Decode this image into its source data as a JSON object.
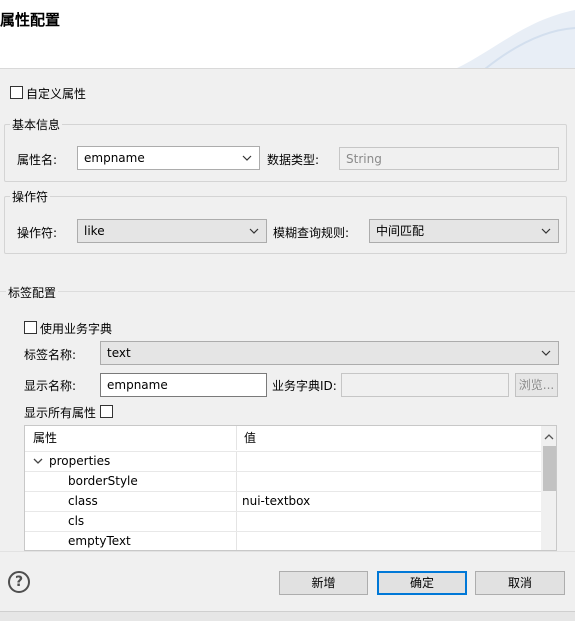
{
  "dialog": {
    "title": "属性配置"
  },
  "custom_attr": {
    "label": "自定义属性"
  },
  "basic_info": {
    "group_title": "基本信息",
    "attr_name_label": "属性名:",
    "attr_name_value": "empname",
    "data_type_label": "数据类型:",
    "data_type_value": "String"
  },
  "operator": {
    "group_title": "操作符",
    "operator_label": "操作符:",
    "operator_value": "like",
    "fuzzy_rule_label": "模糊查询规则:",
    "fuzzy_rule_value": "中间匹配"
  },
  "tag_config": {
    "group_title": "标签配置",
    "use_dict_label": "使用业务字典",
    "tag_name_label": "标签名称:",
    "tag_name_value": "text",
    "display_name_label": "显示名称:",
    "display_name_value": "empname",
    "dict_id_label": "业务字典ID:",
    "dict_id_value": "",
    "browse_label": "浏览...",
    "show_all_label": "显示所有属性"
  },
  "property_table": {
    "headers": [
      "属性",
      "值"
    ],
    "root": "properties",
    "rows": [
      {
        "name": "borderStyle",
        "value": ""
      },
      {
        "name": "class",
        "value": "nui-textbox"
      },
      {
        "name": "cls",
        "value": ""
      },
      {
        "name": "emptyText",
        "value": ""
      }
    ]
  },
  "footer": {
    "help_label": "?",
    "add_label": "新增",
    "ok_label": "确定",
    "cancel_label": "取消"
  }
}
